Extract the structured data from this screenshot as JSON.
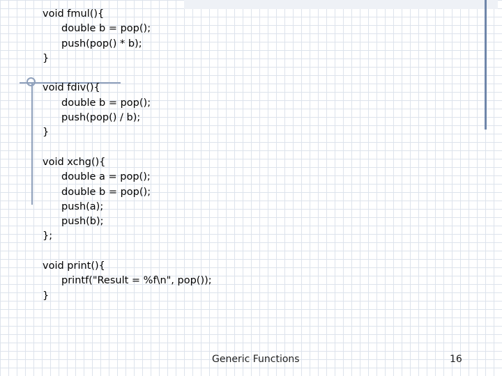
{
  "code_blocks": [
    {
      "lines": [
        {
          "text": "void fmul(){",
          "indent": false
        },
        {
          "text": "double b = pop();",
          "indent": true
        },
        {
          "text": "push(pop() * b);",
          "indent": true
        },
        {
          "text": "}",
          "indent": false
        }
      ]
    },
    {
      "lines": [
        {
          "text": "void fdiv(){",
          "indent": false
        },
        {
          "text": "double b = pop();",
          "indent": true
        },
        {
          "text": "push(pop() / b);",
          "indent": true
        },
        {
          "text": "}",
          "indent": false
        }
      ]
    },
    {
      "lines": [
        {
          "text": "void xchg(){",
          "indent": false
        },
        {
          "text": "double a = pop();",
          "indent": true
        },
        {
          "text": "double b = pop();",
          "indent": true
        },
        {
          "text": "push(a);",
          "indent": true
        },
        {
          "text": "push(b);",
          "indent": true
        },
        {
          "text": "};",
          "indent": false
        }
      ]
    },
    {
      "lines": [
        {
          "text": "void print(){",
          "indent": false
        },
        {
          "text": "printf(\"Result = %f\\n\", pop());",
          "indent": true
        },
        {
          "text": "}",
          "indent": false
        }
      ]
    }
  ],
  "footer": {
    "title": "Generic Functions",
    "page_number": "16"
  }
}
